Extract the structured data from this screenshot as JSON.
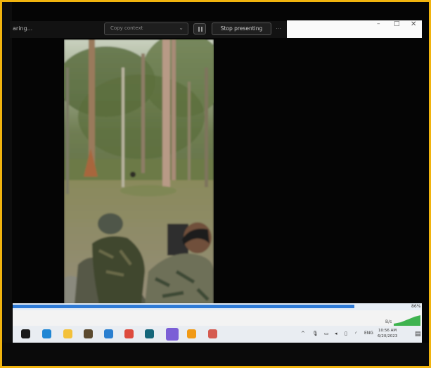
{
  "frame_border_color": "#f1b40e",
  "toolbar": {
    "share_status": "aring...",
    "screen_select": "Copy context",
    "stop_label": "Stop presenting",
    "more_label": "⋯"
  },
  "window_controls": {
    "minimize": "–",
    "maximize": "□",
    "close": "✕"
  },
  "video": {
    "description_icon": "forest-video-frame"
  },
  "progress": {
    "fraction": 0.86,
    "percent_label": "86%"
  },
  "network": {
    "speed_label": "B/s"
  },
  "taskbar": {
    "icons": [
      "windows-start-icon",
      "edge-icon",
      "file-explorer-icon",
      "store-icon",
      "mail-icon",
      "chrome-icon",
      "terminal-icon",
      "teams-icon",
      "vlc-icon",
      "media-icon"
    ],
    "tray_chevron": "^",
    "tray_lang": "ENG",
    "clock_time": "10:56 AM",
    "clock_date": "6/20/2023"
  }
}
